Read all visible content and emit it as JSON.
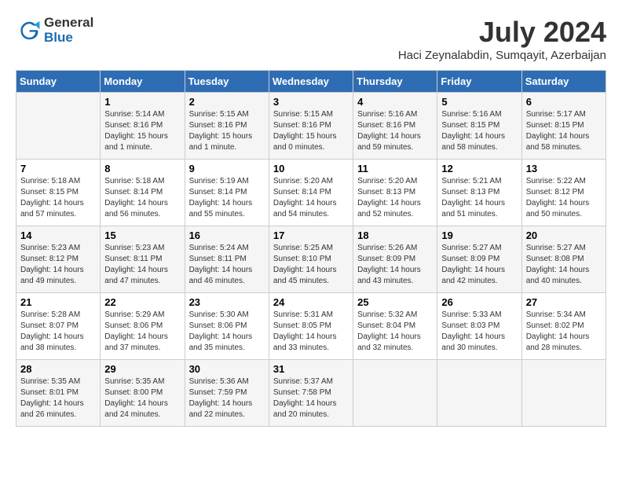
{
  "logo": {
    "line1": "General",
    "line2": "Blue"
  },
  "title": "July 2024",
  "location": "Haci Zeynalabdin, Sumqayit, Azerbaijan",
  "days_of_week": [
    "Sunday",
    "Monday",
    "Tuesday",
    "Wednesday",
    "Thursday",
    "Friday",
    "Saturday"
  ],
  "weeks": [
    [
      null,
      {
        "day": "1",
        "sunrise": "5:14 AM",
        "sunset": "8:16 PM",
        "daylight": "15 hours and 1 minute."
      },
      {
        "day": "2",
        "sunrise": "5:15 AM",
        "sunset": "8:16 PM",
        "daylight": "15 hours and 1 minute."
      },
      {
        "day": "3",
        "sunrise": "5:15 AM",
        "sunset": "8:16 PM",
        "daylight": "15 hours and 0 minutes."
      },
      {
        "day": "4",
        "sunrise": "5:16 AM",
        "sunset": "8:16 PM",
        "daylight": "14 hours and 59 minutes."
      },
      {
        "day": "5",
        "sunrise": "5:16 AM",
        "sunset": "8:15 PM",
        "daylight": "14 hours and 58 minutes."
      },
      {
        "day": "6",
        "sunrise": "5:17 AM",
        "sunset": "8:15 PM",
        "daylight": "14 hours and 58 minutes."
      }
    ],
    [
      {
        "day": "7",
        "sunrise": "5:18 AM",
        "sunset": "8:15 PM",
        "daylight": "14 hours and 57 minutes."
      },
      {
        "day": "8",
        "sunrise": "5:18 AM",
        "sunset": "8:14 PM",
        "daylight": "14 hours and 56 minutes."
      },
      {
        "day": "9",
        "sunrise": "5:19 AM",
        "sunset": "8:14 PM",
        "daylight": "14 hours and 55 minutes."
      },
      {
        "day": "10",
        "sunrise": "5:20 AM",
        "sunset": "8:14 PM",
        "daylight": "14 hours and 54 minutes."
      },
      {
        "day": "11",
        "sunrise": "5:20 AM",
        "sunset": "8:13 PM",
        "daylight": "14 hours and 52 minutes."
      },
      {
        "day": "12",
        "sunrise": "5:21 AM",
        "sunset": "8:13 PM",
        "daylight": "14 hours and 51 minutes."
      },
      {
        "day": "13",
        "sunrise": "5:22 AM",
        "sunset": "8:12 PM",
        "daylight": "14 hours and 50 minutes."
      }
    ],
    [
      {
        "day": "14",
        "sunrise": "5:23 AM",
        "sunset": "8:12 PM",
        "daylight": "14 hours and 49 minutes."
      },
      {
        "day": "15",
        "sunrise": "5:23 AM",
        "sunset": "8:11 PM",
        "daylight": "14 hours and 47 minutes."
      },
      {
        "day": "16",
        "sunrise": "5:24 AM",
        "sunset": "8:11 PM",
        "daylight": "14 hours and 46 minutes."
      },
      {
        "day": "17",
        "sunrise": "5:25 AM",
        "sunset": "8:10 PM",
        "daylight": "14 hours and 45 minutes."
      },
      {
        "day": "18",
        "sunrise": "5:26 AM",
        "sunset": "8:09 PM",
        "daylight": "14 hours and 43 minutes."
      },
      {
        "day": "19",
        "sunrise": "5:27 AM",
        "sunset": "8:09 PM",
        "daylight": "14 hours and 42 minutes."
      },
      {
        "day": "20",
        "sunrise": "5:27 AM",
        "sunset": "8:08 PM",
        "daylight": "14 hours and 40 minutes."
      }
    ],
    [
      {
        "day": "21",
        "sunrise": "5:28 AM",
        "sunset": "8:07 PM",
        "daylight": "14 hours and 38 minutes."
      },
      {
        "day": "22",
        "sunrise": "5:29 AM",
        "sunset": "8:06 PM",
        "daylight": "14 hours and 37 minutes."
      },
      {
        "day": "23",
        "sunrise": "5:30 AM",
        "sunset": "8:06 PM",
        "daylight": "14 hours and 35 minutes."
      },
      {
        "day": "24",
        "sunrise": "5:31 AM",
        "sunset": "8:05 PM",
        "daylight": "14 hours and 33 minutes."
      },
      {
        "day": "25",
        "sunrise": "5:32 AM",
        "sunset": "8:04 PM",
        "daylight": "14 hours and 32 minutes."
      },
      {
        "day": "26",
        "sunrise": "5:33 AM",
        "sunset": "8:03 PM",
        "daylight": "14 hours and 30 minutes."
      },
      {
        "day": "27",
        "sunrise": "5:34 AM",
        "sunset": "8:02 PM",
        "daylight": "14 hours and 28 minutes."
      }
    ],
    [
      {
        "day": "28",
        "sunrise": "5:35 AM",
        "sunset": "8:01 PM",
        "daylight": "14 hours and 26 minutes."
      },
      {
        "day": "29",
        "sunrise": "5:35 AM",
        "sunset": "8:00 PM",
        "daylight": "14 hours and 24 minutes."
      },
      {
        "day": "30",
        "sunrise": "5:36 AM",
        "sunset": "7:59 PM",
        "daylight": "14 hours and 22 minutes."
      },
      {
        "day": "31",
        "sunrise": "5:37 AM",
        "sunset": "7:58 PM",
        "daylight": "14 hours and 20 minutes."
      },
      null,
      null,
      null
    ]
  ]
}
